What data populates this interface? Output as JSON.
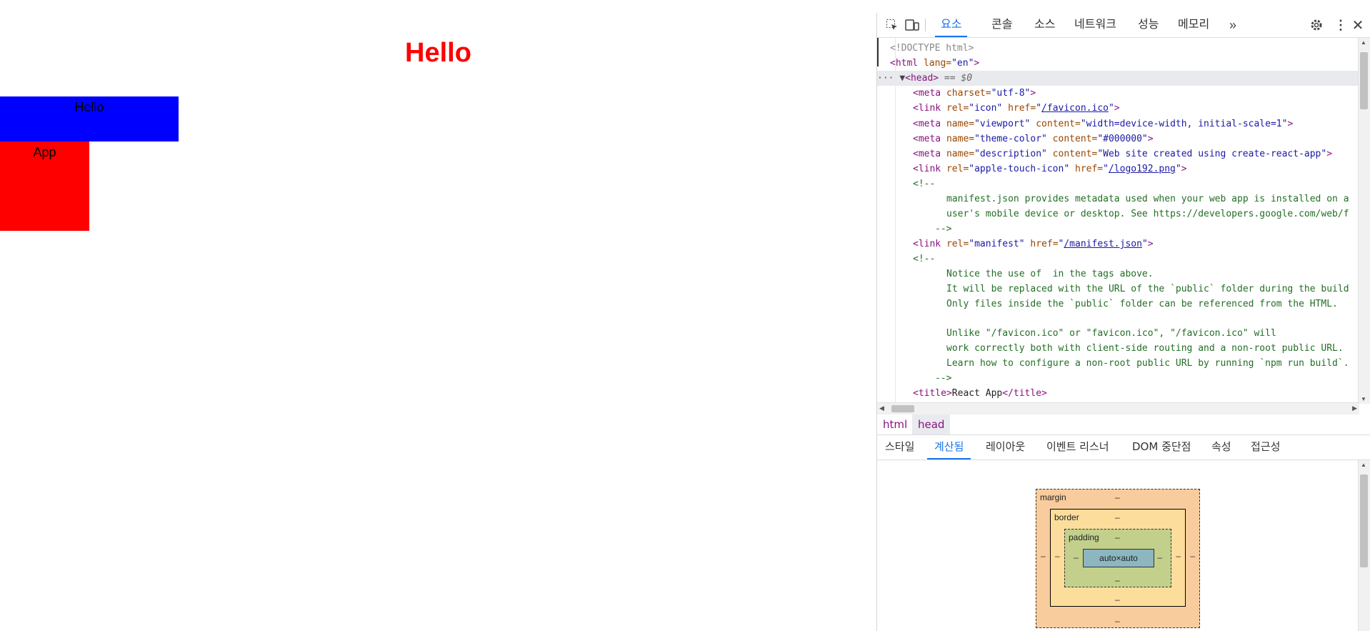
{
  "page": {
    "heading": "Hello",
    "blue_box_text": "Hello",
    "red_box_text": "App"
  },
  "devtools": {
    "tabs": [
      "요소",
      "콘솔",
      "소스",
      "네트워크",
      "성능",
      "메모리"
    ],
    "active_tab": "요소",
    "overflow_icon": "double-chevron-right-icon",
    "code_lines": {
      "l1": "<!DOCTYPE html>",
      "l2_tag_open": "<html",
      "l2_attr": " lang=",
      "l2_val": "\"en\"",
      "l2_tag_close": ">",
      "l3_head": "<head>",
      "l3_eq": " == $0",
      "meta_charset_attr": "charset=",
      "meta_charset_val": "\"utf-8\"",
      "link_icon_rel": "\"icon\"",
      "link_icon_href": "/favicon.ico",
      "viewport_name": "\"viewport\"",
      "viewport_content": "\"width=device-width, initial-scale=1\"",
      "theme_name": "\"theme-color\"",
      "theme_content": "\"#000000\"",
      "desc_name": "\"description\"",
      "desc_content": "\"Web site created using create-react-app\"",
      "apple_rel": "\"apple-touch-icon\"",
      "apple_href": "/logo192.png",
      "comment_open": "<!--",
      "comment1_a": "manifest.json provides metadata used when your web app is installed on a",
      "comment1_b": "user's mobile device or desktop. See https://developers.google.com/web/f",
      "comment_close": "-->",
      "manifest_rel": "\"manifest\"",
      "manifest_href": "/manifest.json",
      "comment2_a": "Notice the use of  in the tags above.",
      "comment2_b": "It will be replaced with the URL of the `public` folder during the build",
      "comment2_c": "Only files inside the `public` folder can be referenced from the HTML.",
      "comment2_d": "Unlike \"/favicon.ico\" or \"favicon.ico\", \"/favicon.ico\" will",
      "comment2_e": "work correctly both with client-side routing and a non-root public URL.",
      "comment2_f": "Learn how to configure a non-root public URL by running `npm run build`.",
      "title_open": "<title>",
      "title_text": "React App",
      "title_close": "</title>"
    },
    "breadcrumbs": [
      "html",
      "head"
    ],
    "subtabs": [
      "스타일",
      "계산됨",
      "레이아웃",
      "이벤트 리스너",
      "DOM 중단점",
      "속성",
      "접근성"
    ],
    "active_subtab": "계산됨",
    "box_model": {
      "margin_label": "margin",
      "border_label": "border",
      "padding_label": "padding",
      "content": "auto×auto",
      "dash": "–"
    }
  },
  "colors": {
    "heading": "#ff0000",
    "blue_box": "#0000ff",
    "red_box": "#ff0000",
    "accent": "#1a73e8",
    "margin_box": "#f9cc9d",
    "border_box": "#fddd9b",
    "padding_box": "#c3d08b",
    "content_box": "#8cb6c0"
  }
}
